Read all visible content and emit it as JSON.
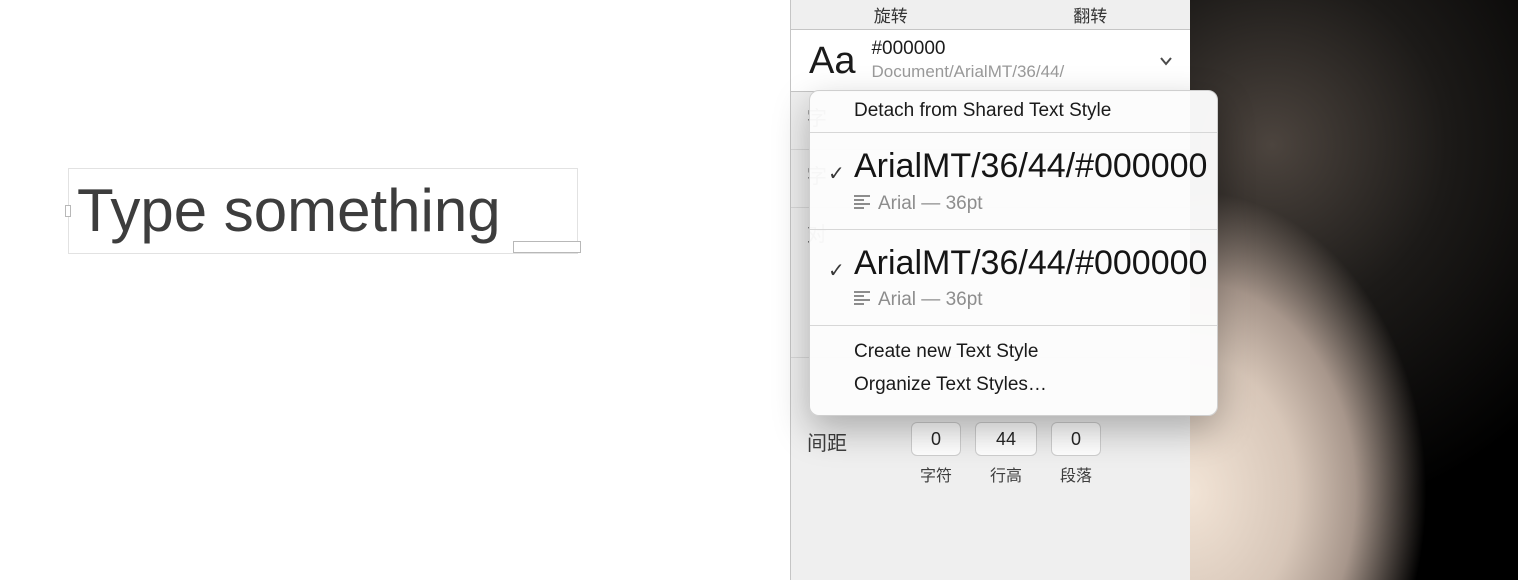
{
  "canvas": {
    "placeholder_text": "Type something"
  },
  "inspector": {
    "tabs": {
      "rotate": "旋转",
      "flip": "翻转"
    },
    "style_picker": {
      "preview_letters": "Aa",
      "current_name": "#000000",
      "current_path": "Document/ArialMT/36/44/"
    },
    "section_font_label": "字",
    "section_size_label": "字",
    "alignment_label": "对",
    "spacing": {
      "label": "间距",
      "char_value": "0",
      "char_caption": "字符",
      "line_value": "44",
      "line_caption": "行高",
      "para_value": "0",
      "para_caption": "段落"
    }
  },
  "dropdown": {
    "detach": "Detach from Shared Text Style",
    "styles": [
      {
        "name": "ArialMT/36/44/#000000",
        "meta": "Arial — 36pt"
      },
      {
        "name": "ArialMT/36/44/#000000",
        "meta": "Arial — 36pt"
      }
    ],
    "create": "Create new Text Style",
    "organize": "Organize Text Styles…"
  }
}
